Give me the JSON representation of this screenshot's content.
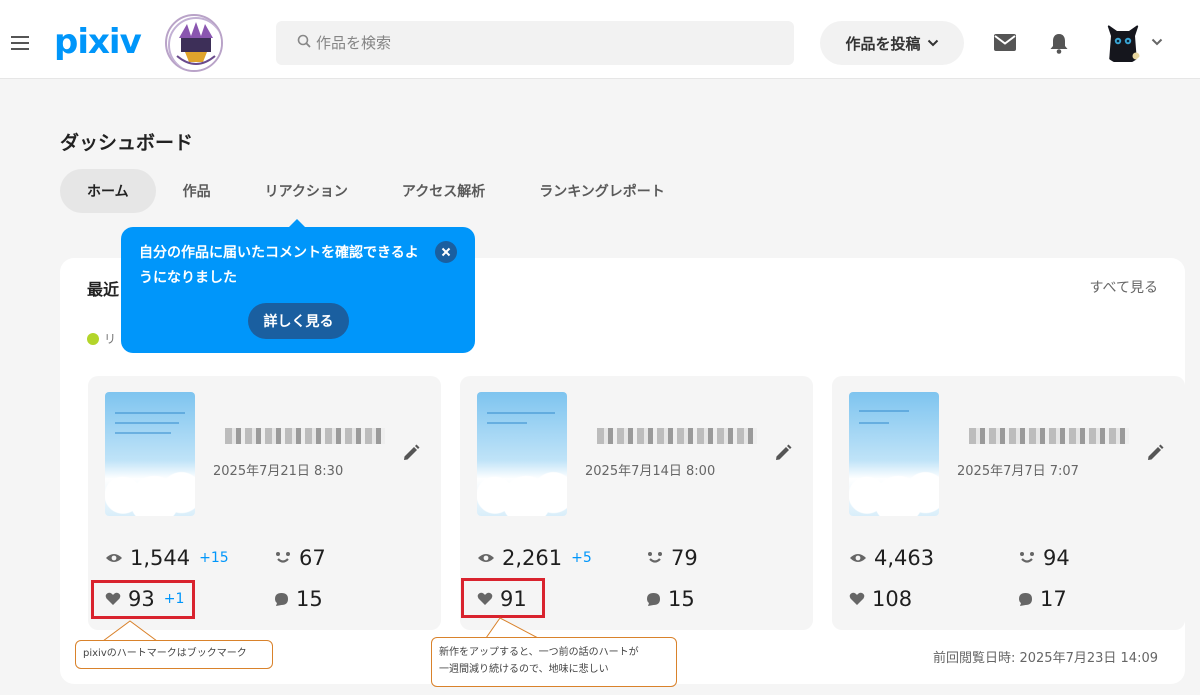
{
  "header": {
    "logo": "pixiv",
    "search_placeholder": "作品を検索",
    "post_button": "作品を投稿"
  },
  "dashboard": {
    "title": "ダッシュボード",
    "tabs": [
      "ホーム",
      "作品",
      "リアクション",
      "アクセス解析",
      "ランキングレポート"
    ]
  },
  "tooltip": {
    "message": "自分の作品に届いたコメントを確認できるようになりました",
    "button": "詳しく見る"
  },
  "panel": {
    "heading_visible": "最近",
    "see_all": "すべて見る",
    "legend_visible": "リ",
    "last_viewed": "前回閲覧日時: 2025年7月23日 14:09"
  },
  "works": [
    {
      "date": "2025年7月21日 8:30",
      "views": "1,544",
      "views_delta": "+15",
      "reactions": "67",
      "likes": "93",
      "likes_delta": "+1",
      "comments": "15"
    },
    {
      "date": "2025年7月14日 8:00",
      "views": "2,261",
      "views_delta": "+5",
      "reactions": "79",
      "likes": "91",
      "likes_delta": "",
      "comments": "15"
    },
    {
      "date": "2025年7月7日 7:07",
      "views": "4,463",
      "views_delta": "",
      "reactions": "94",
      "likes": "108",
      "likes_delta": "",
      "comments": "17"
    }
  ],
  "annotations": {
    "note1": "pixivのハートマークはブックマーク",
    "note2_line1": "新作をアップすると、一つ前の話のハートが",
    "note2_line2": "一週間減り続けるので、地味に悲しい"
  },
  "colors": {
    "accent": "#0096fa",
    "annotation_box": "#d9232e",
    "note_border": "#d9822b",
    "legend_dot": "#b3d52a"
  }
}
